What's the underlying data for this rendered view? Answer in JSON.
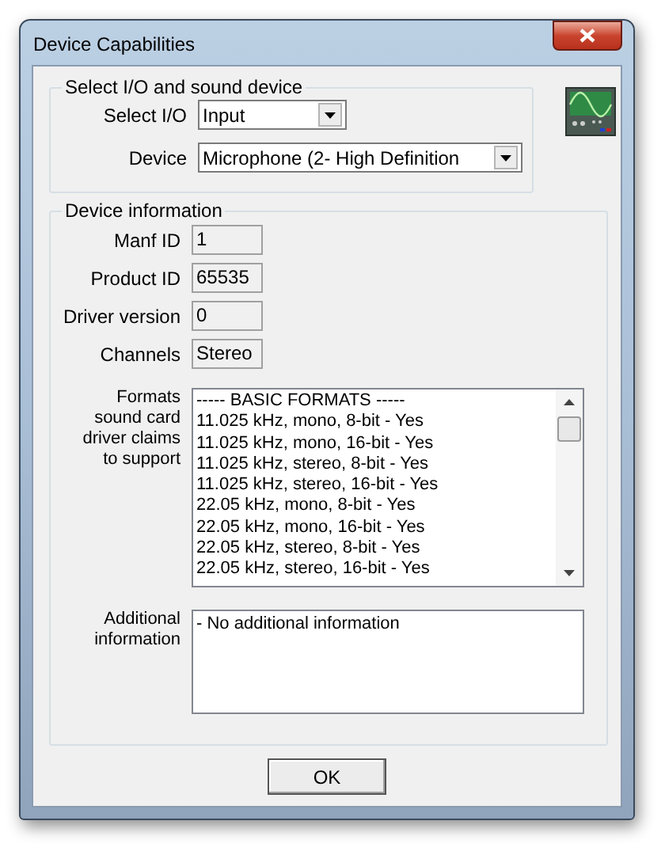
{
  "window": {
    "title": "Device Capabilities"
  },
  "device_selection": {
    "legend": "Select I/O and sound device",
    "fields": [
      {
        "label": "Select I/O",
        "value": "Input"
      },
      {
        "label": "Device",
        "value": "Microphone (2- High Definition"
      }
    ]
  },
  "device_information": {
    "legend": "Device information",
    "fields": [
      {
        "label": "Manf ID",
        "value": "1"
      },
      {
        "label": "Product ID",
        "value": "65535"
      },
      {
        "label": "Driver version",
        "value": "0"
      },
      {
        "label": "Channels",
        "value": "Stereo"
      }
    ],
    "formats": {
      "label": "Formats sound card driver claims to support",
      "items": [
        "----- BASIC FORMATS -----",
        "11.025 kHz, mono, 8-bit - Yes",
        "11.025 kHz, mono, 16-bit - Yes",
        "11.025 kHz, stereo, 8-bit - Yes",
        "11.025 kHz, stereo, 16-bit - Yes",
        "22.05 kHz, mono, 8-bit - Yes",
        "22.05 kHz, mono, 16-bit - Yes",
        "22.05 kHz, stereo, 8-bit - Yes",
        "22.05 kHz, stereo, 16-bit - Yes"
      ]
    },
    "additional": {
      "label": "Additional information",
      "text": "- No additional information"
    }
  },
  "buttons": [
    "OK"
  ]
}
